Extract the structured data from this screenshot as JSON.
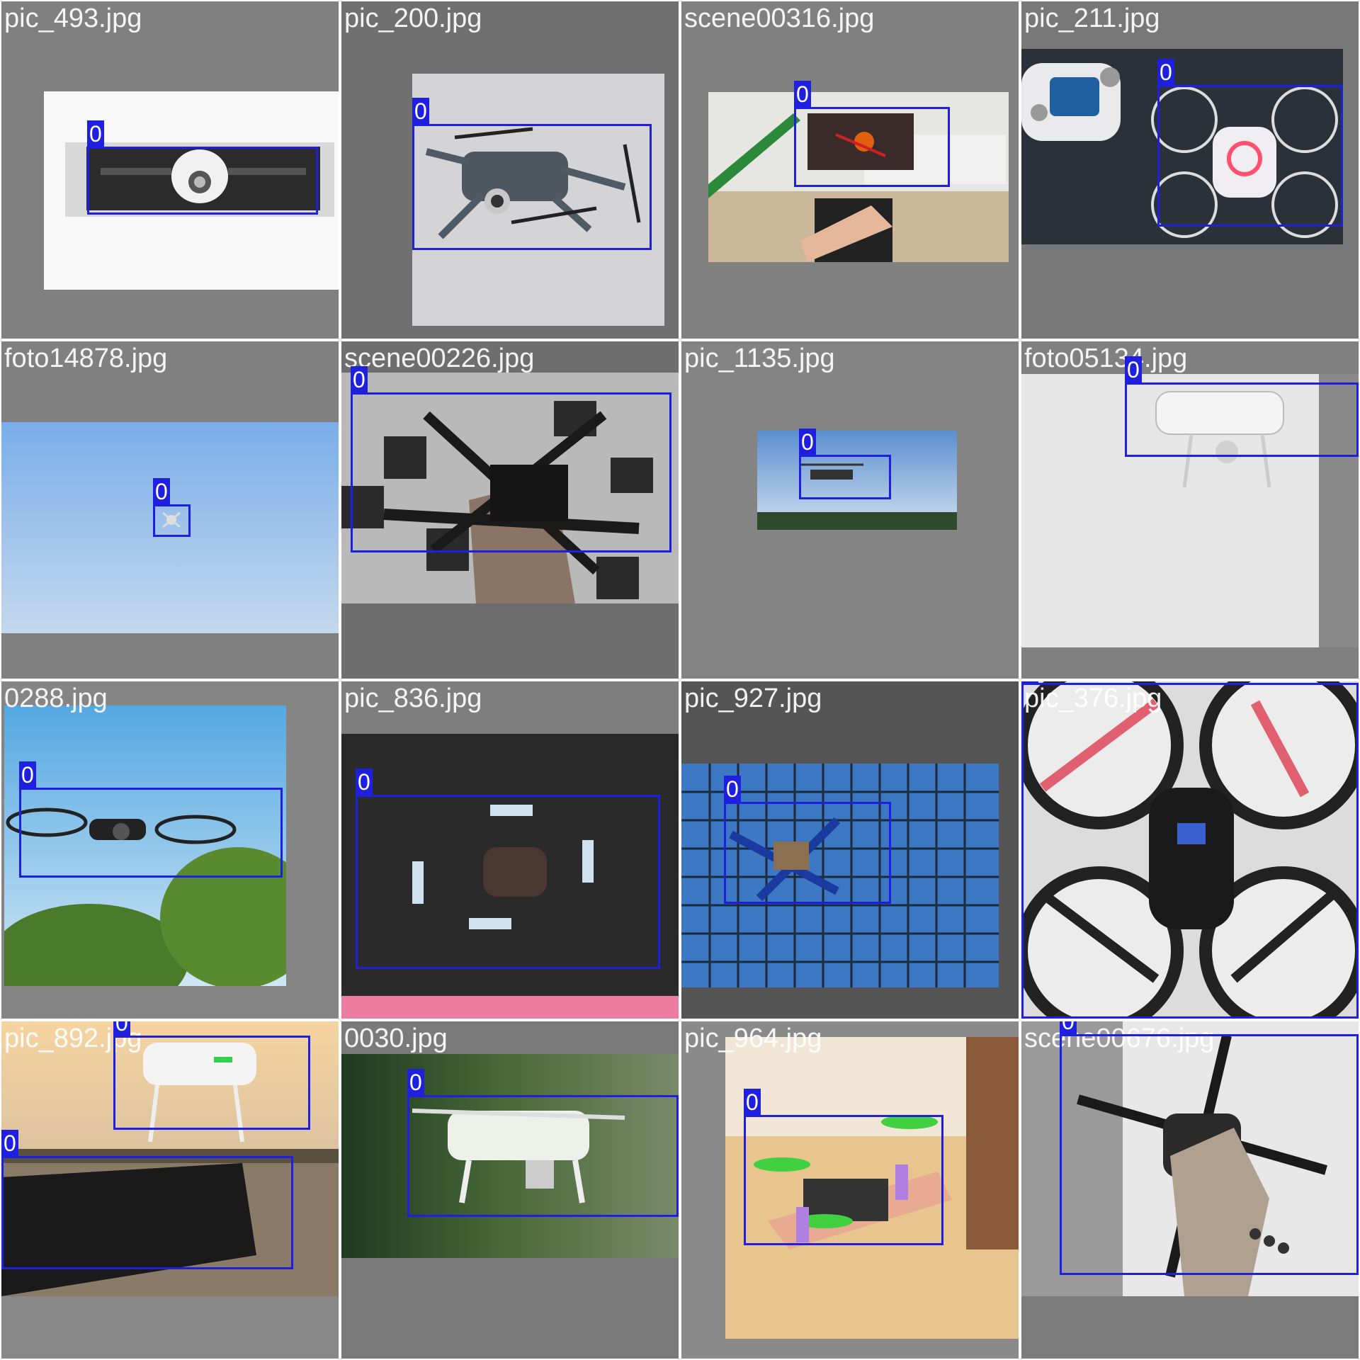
{
  "tiles": [
    {
      "filename": "pic_493.jpg",
      "boxes": [
        {
          "label": "0"
        }
      ]
    },
    {
      "filename": "pic_200.jpg",
      "boxes": [
        {
          "label": "0"
        }
      ]
    },
    {
      "filename": "scene00316.jpg",
      "boxes": [
        {
          "label": "0"
        }
      ]
    },
    {
      "filename": "pic_211.jpg",
      "boxes": [
        {
          "label": "0"
        }
      ]
    },
    {
      "filename": "foto14878.jpg",
      "boxes": [
        {
          "label": "0"
        }
      ]
    },
    {
      "filename": "scene00226.jpg",
      "boxes": [
        {
          "label": "0"
        }
      ]
    },
    {
      "filename": "pic_1135.jpg",
      "boxes": [
        {
          "label": "0"
        }
      ]
    },
    {
      "filename": "foto05134.jpg",
      "boxes": [
        {
          "label": "0"
        }
      ]
    },
    {
      "filename": "0288.jpg",
      "boxes": [
        {
          "label": "0"
        }
      ]
    },
    {
      "filename": "pic_836.jpg",
      "boxes": [
        {
          "label": "0"
        }
      ]
    },
    {
      "filename": "pic_927.jpg",
      "boxes": [
        {
          "label": "0"
        }
      ]
    },
    {
      "filename": "pic_376.jpg",
      "boxes": [
        {
          "label": "0"
        }
      ]
    },
    {
      "filename": "pic_892.jpg",
      "boxes": [
        {
          "label": "0"
        },
        {
          "label": "0"
        }
      ]
    },
    {
      "filename": "0030.jpg",
      "boxes": [
        {
          "label": "0"
        }
      ]
    },
    {
      "filename": "pic_964.jpg",
      "boxes": [
        {
          "label": "0"
        }
      ]
    },
    {
      "filename": "scene00676.jpg",
      "boxes": [
        {
          "label": "0"
        }
      ]
    }
  ]
}
